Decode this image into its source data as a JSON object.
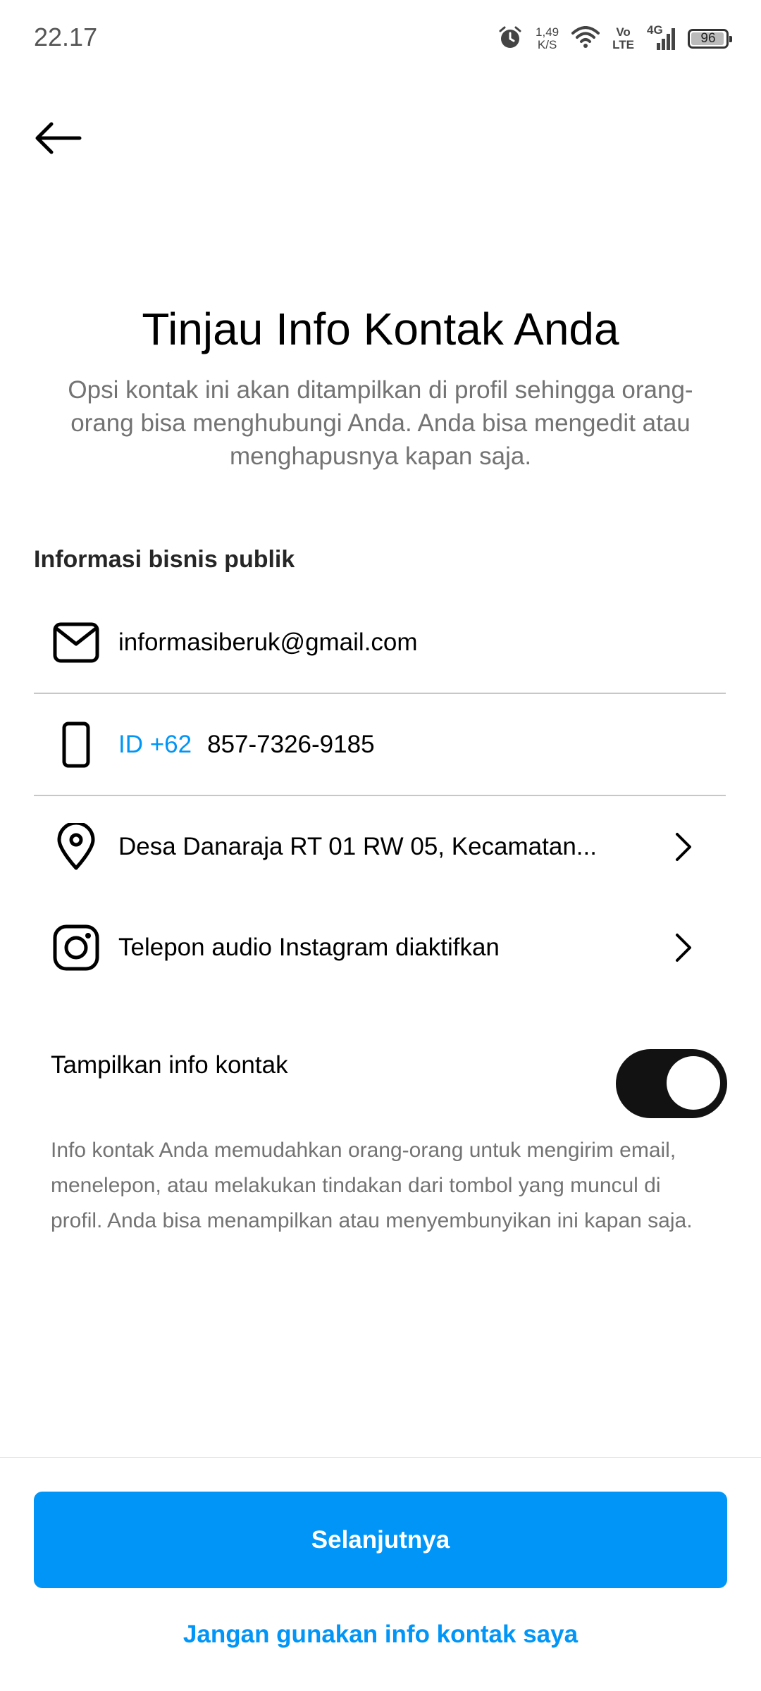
{
  "status_bar": {
    "time": "22.17",
    "net_speed_value": "1,49",
    "net_speed_unit": "K/S",
    "volte_top": "Vo",
    "volte_bottom": "LTE",
    "network_type": "4G",
    "battery": "96",
    "battery_level": 0.96,
    "icons": [
      "alarm-icon",
      "wifi-icon",
      "signal-icon",
      "battery-icon"
    ]
  },
  "header": {
    "back_icon": "arrow-left-icon",
    "title": "Tinjau Info Kontak Anda",
    "subtitle": "Opsi kontak ini akan ditampilkan di profil sehingga orang-orang bisa menghubungi Anda. Anda bisa mengedit atau menghapusnya kapan saja."
  },
  "section": {
    "title": "Informasi bisnis publik",
    "email": {
      "icon": "mail-icon",
      "value": "informasiberuk@gmail.com"
    },
    "phone": {
      "icon": "phone-icon",
      "country_code": "ID +62",
      "number": "857-7326-9185"
    },
    "address": {
      "icon": "location-pin-icon",
      "value": "Desa Danaraja RT 01 RW 05, Kecamatan..."
    },
    "instagram_call": {
      "icon": "instagram-icon",
      "value": "Telepon audio Instagram diaktifkan"
    }
  },
  "toggle": {
    "label": "Tampilkan info kontak",
    "on": true,
    "description": "Info kontak Anda memudahkan orang-orang untuk mengirim email, menelepon, atau melakukan tindakan dari tombol yang muncul di profil. Anda bisa menampilkan atau menyembunyikan ini kapan saja."
  },
  "footer": {
    "primary_button": "Selanjutnya",
    "secondary_link": "Jangan gunakan info kontak saya"
  },
  "colors": {
    "accent": "#0095f6",
    "toggle_on": "#121212",
    "secondary_text": "#737373",
    "divider": "#c7c7c7"
  }
}
